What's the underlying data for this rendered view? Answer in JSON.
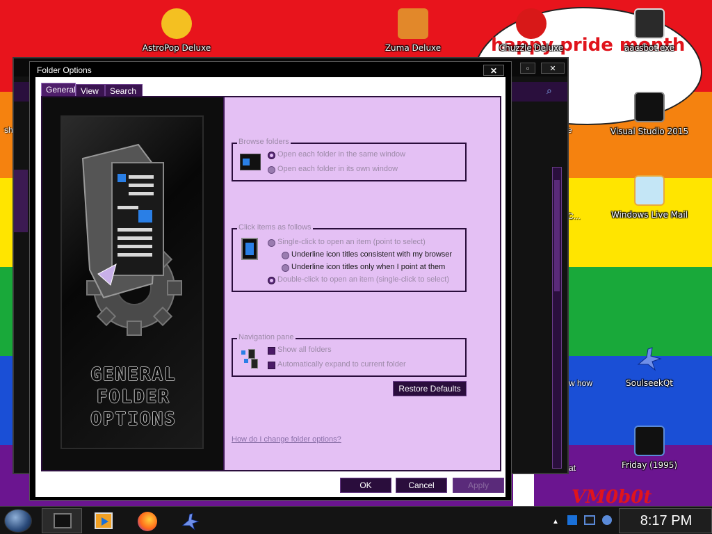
{
  "desktop": {
    "banner_text": "happy pride month e!",
    "logo_text": "VM0b0t",
    "icons": [
      {
        "label": "AstroPop Deluxe",
        "icon": "astropop-icon"
      },
      {
        "label": "Zuma Deluxe",
        "icon": "zuma-icon"
      },
      {
        "label": "Chuzzle Deluxe",
        "icon": "chuzzle-icon"
      },
      {
        "label": "aacsbot.exe",
        "icon": "window-stack-icon"
      },
      {
        "label": "Visual Studio 2015",
        "icon": "visual-studio-icon"
      },
      {
        "label": "Windows Live Mail",
        "icon": "mail-icon"
      },
      {
        "label": "SoulseekQt",
        "icon": "bird-icon"
      },
      {
        "label": "Friday (1995)",
        "icon": "video-icon"
      }
    ],
    "partial_labels": [
      "sh",
      "C...",
      "w how",
      "at",
      "e"
    ]
  },
  "dialog": {
    "title": "Folder Options",
    "close_label": "✕",
    "tabs": [
      "General",
      "View",
      "Search"
    ],
    "art_title": [
      "GENERAL",
      "FOLDER",
      "OPTIONS"
    ],
    "browse": {
      "label": "Browse folders",
      "options": [
        "Open each folder in the same window",
        "Open each folder in its own window"
      ]
    },
    "click": {
      "label": "Click items as follows",
      "options": [
        "Single-click to open an item (point to select)",
        "Underline icon titles consistent with my browser",
        "Underline icon titles only when I point at them",
        "Double-click to open an item (single-click to select)"
      ]
    },
    "nav": {
      "label": "Navigation pane",
      "options": [
        "Show all folders",
        "Automatically expand to current folder"
      ]
    },
    "restore_label": "Restore Defaults",
    "help_link": "How do I change folder options?",
    "buttons": {
      "ok": "OK",
      "cancel": "Cancel",
      "apply": "Apply"
    }
  },
  "taskbar": {
    "clock": "8:17 PM"
  }
}
